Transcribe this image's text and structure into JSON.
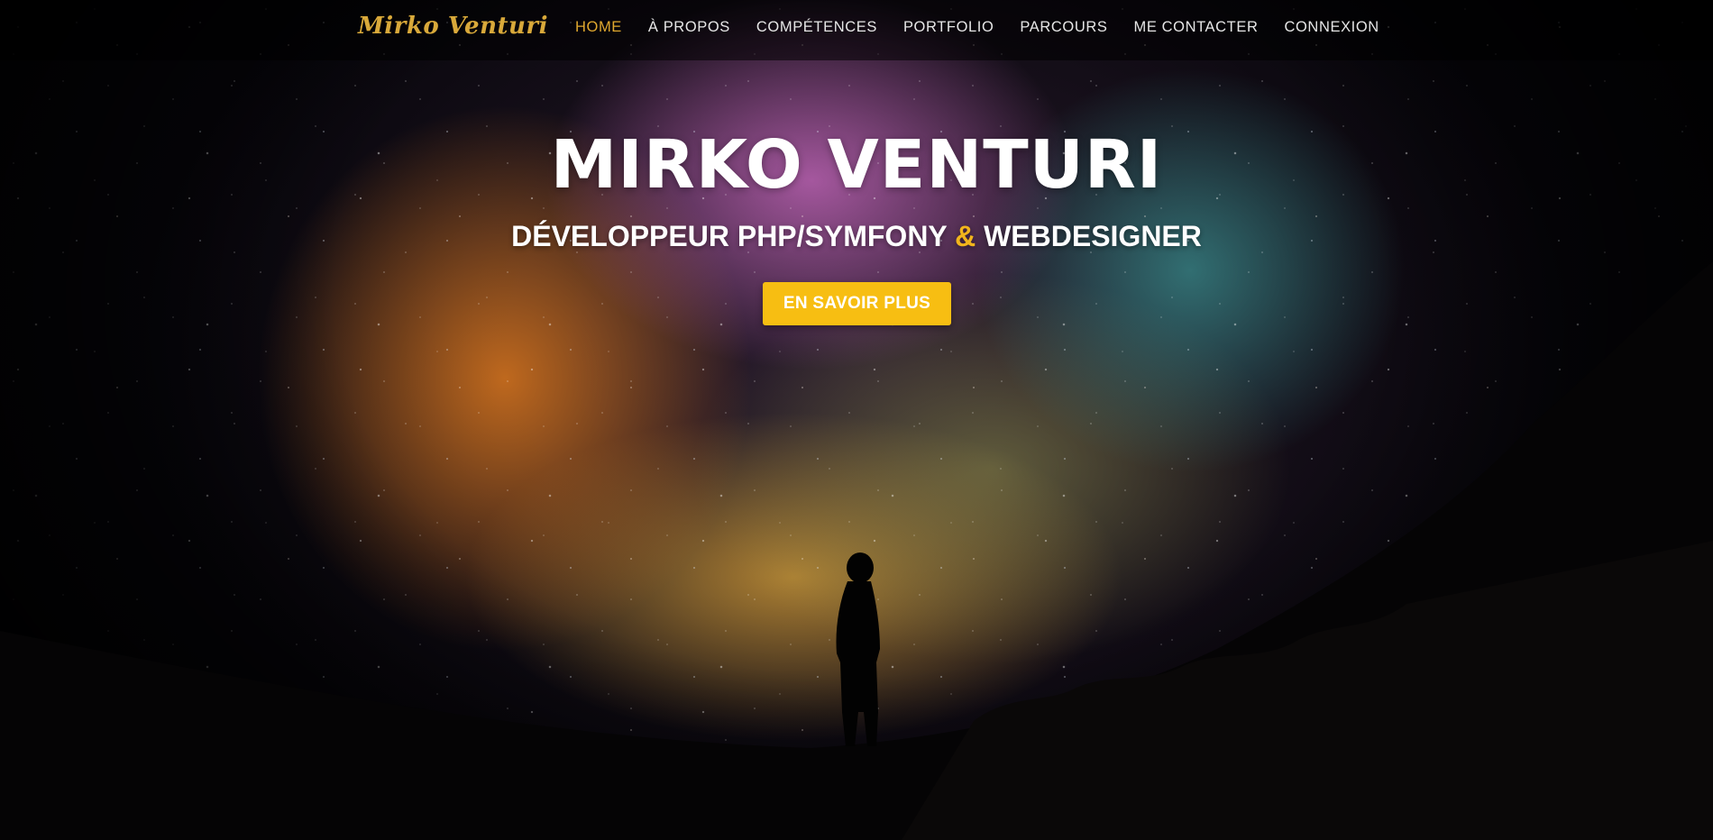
{
  "brand": {
    "name": "Mirko Venturi"
  },
  "nav": {
    "items": [
      {
        "label": "HOME",
        "active": true
      },
      {
        "label": "À PROPOS",
        "active": false
      },
      {
        "label": "COMPÉTENCES",
        "active": false
      },
      {
        "label": "PORTFOLIO",
        "active": false
      },
      {
        "label": "PARCOURS",
        "active": false
      },
      {
        "label": "ME CONTACTER",
        "active": false
      },
      {
        "label": "CONNEXION",
        "active": false
      }
    ]
  },
  "hero": {
    "title": "MIRKO VENTURI",
    "subtitle_part1": "DÉVELOPPEUR PHP/SYMFONY",
    "subtitle_amp": "&",
    "subtitle_part2": "WEBDESIGNER",
    "cta_label": "EN SAVOIR PLUS",
    "background": "starry-night-sky-with-silhouette"
  },
  "colors": {
    "accent": "#f7be12",
    "brand": "#d9a93a",
    "nav_active": "#e0a82e",
    "nav_text": "#e6e6e6"
  }
}
